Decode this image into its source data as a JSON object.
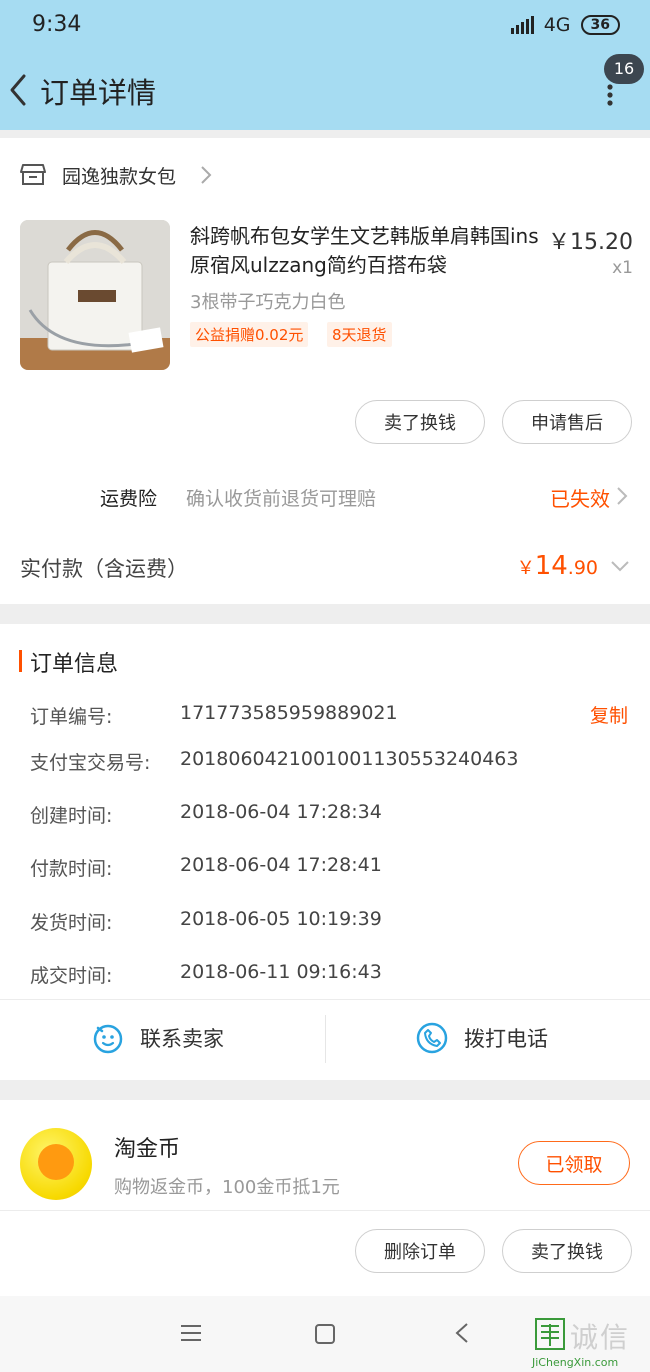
{
  "status_bar": {
    "time": "9:34",
    "network": "4G",
    "battery": "36"
  },
  "header": {
    "title": "订单详情",
    "badge_count": "16",
    "back_icon": "chevron-left-icon",
    "more_icon": "more-vertical-icon"
  },
  "shop": {
    "name": "园逸独款女包",
    "icon": "store-icon"
  },
  "product": {
    "title": "斜跨帆布包女学生文艺韩版单肩韩国ins原宿风ulzzang简约百搭布袋",
    "price": "￥15.20",
    "quantity": "x1",
    "sku": "3根带子巧克力白色",
    "tags": [
      "公益捐赠0.02元",
      "8天退货"
    ]
  },
  "item_actions": {
    "sell_label": "卖了换钱",
    "after_sale_label": "申请售后"
  },
  "insurance": {
    "label": "运费险",
    "description": "确认收货前退货可理赔",
    "status": "已失效"
  },
  "payment": {
    "label": "实付款（含运费）",
    "currency": "￥",
    "amount_int": "14",
    "amount_dec": ".90"
  },
  "order_info": {
    "title": "订单信息",
    "copy_label": "复制",
    "rows": [
      {
        "label": "订单编号:",
        "value": "171773585959889021"
      },
      {
        "label": "支付宝交易号:",
        "value": "2018060421001001130553240463"
      },
      {
        "label": "创建时间:",
        "value": "2018-06-04 17:28:34"
      },
      {
        "label": "付款时间:",
        "value": "2018-06-04 17:28:41"
      },
      {
        "label": "发货时间:",
        "value": "2018-06-05 10:19:39"
      },
      {
        "label": "成交时间:",
        "value": "2018-06-11 09:16:43"
      }
    ]
  },
  "contact": {
    "seller_label": "联系卖家",
    "phone_label": "拨打电话"
  },
  "coins": {
    "title": "淘金币",
    "description": "购物返金币，100金币抵1元",
    "button_label": "已领取"
  },
  "bottom_actions": {
    "delete_label": "删除订单",
    "sell_label": "卖了换钱"
  },
  "watermark": {
    "text": "诚信",
    "subtext": "JiChengXin.com"
  },
  "colors": {
    "accent": "#ff5000",
    "header_bg": "#a6dcf2",
    "contact_icon": "#29a3e0"
  }
}
